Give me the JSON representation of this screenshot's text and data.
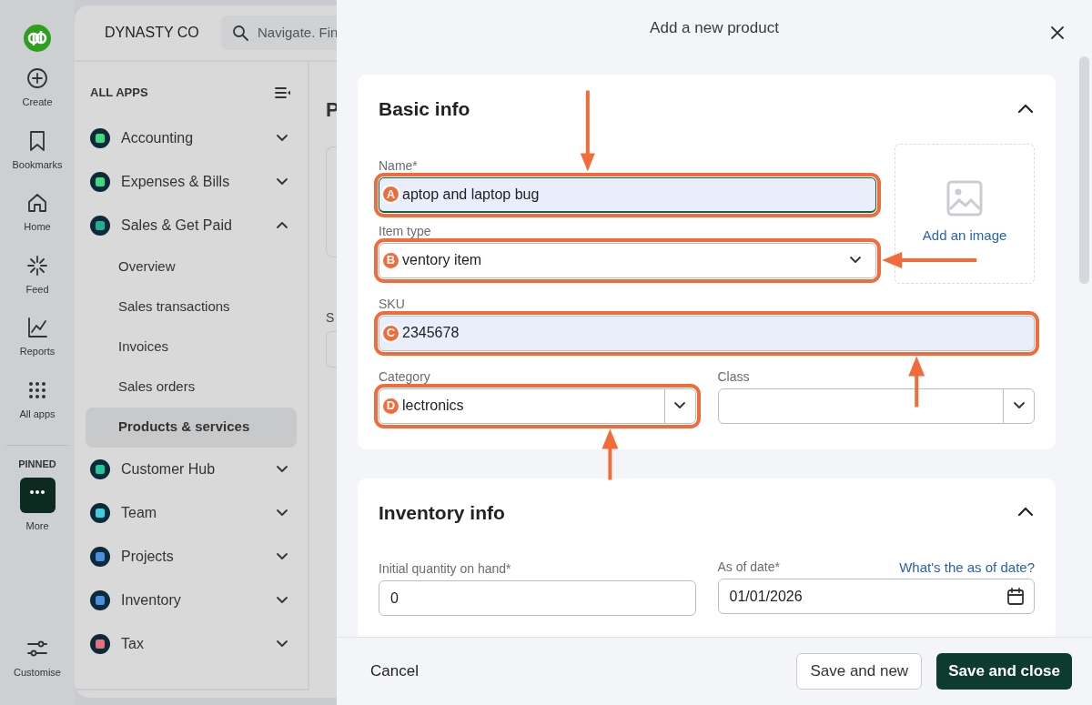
{
  "rail": {
    "items": [
      {
        "label": "Create"
      },
      {
        "label": "Bookmarks"
      },
      {
        "label": "Home"
      },
      {
        "label": "Feed"
      },
      {
        "label": "Reports"
      },
      {
        "label": "All apps"
      }
    ],
    "pinned_heading": "PINNED",
    "pinned": [
      {
        "label": "More"
      }
    ],
    "bottom": {
      "label": "Customise"
    }
  },
  "header": {
    "company": "DYNASTY CO",
    "search": {
      "placeholder": "Navigate. Fin"
    }
  },
  "sidebar": {
    "heading": "ALL APPS",
    "apps": [
      {
        "label": "Accounting",
        "color": "#3ddc84",
        "expanded": false
      },
      {
        "label": "Expenses & Bills",
        "color": "#3ddc84",
        "expanded": false
      },
      {
        "label": "Sales & Get Paid",
        "color": "#21b08e",
        "expanded": true,
        "children": [
          {
            "label": "Overview",
            "selected": false
          },
          {
            "label": "Sales transactions",
            "selected": false
          },
          {
            "label": "Invoices",
            "selected": false
          },
          {
            "label": "Sales orders",
            "selected": false
          },
          {
            "label": "Products & services",
            "selected": true
          }
        ]
      },
      {
        "label": "Customer Hub",
        "color": "#1ec9a0",
        "expanded": false
      },
      {
        "label": "Team",
        "color": "#3ecfe0",
        "expanded": false
      },
      {
        "label": "Projects",
        "color": "#4a8fe0",
        "expanded": false
      },
      {
        "label": "Inventory",
        "color": "#4a8fe0",
        "expanded": false
      },
      {
        "label": "Tax",
        "color": "#e8707a",
        "expanded": false
      }
    ]
  },
  "page": {
    "title": "P",
    "label": "S"
  },
  "drawer": {
    "title": "Add a new product",
    "sections": [
      {
        "title": "Basic info",
        "expanded": true,
        "image": {
          "label": "Add an image"
        },
        "fields": [
          {
            "kind": "text",
            "label": "Name*",
            "value": "aptop and laptop bug",
            "marker": "A",
            "highlighted": true,
            "arrow": {
              "kind": "down"
            },
            "autofilled": true,
            "focused": true
          },
          {
            "kind": "dropdown",
            "label": "Item type",
            "value": "ventory item",
            "marker": "B",
            "highlighted": true,
            "arrow": {
              "kind": "left"
            },
            "autofilled": false,
            "focused": false
          },
          {
            "kind": "text",
            "label": "SKU",
            "value": "2345678",
            "marker": "C",
            "highlighted": true,
            "arrow": {
              "kind": "up"
            },
            "autofilled": true,
            "focused": false
          },
          {
            "kind": "combo",
            "label": "Category",
            "value": "lectronics",
            "marker": "D",
            "highlighted": true,
            "arrow": {
              "kind": "up"
            },
            "autofilled": false,
            "focused": false
          },
          {
            "kind": "combo",
            "label": "Class",
            "highlighted": false,
            "autofilled": false,
            "focused": false
          }
        ]
      },
      {
        "title": "Inventory info",
        "expanded": true,
        "link": "What's the as of date?",
        "fields": [
          {
            "kind": "text",
            "label": "Initial quantity on hand*",
            "value": "0",
            "highlighted": false,
            "autofilled": false,
            "focused": false
          },
          {
            "kind": "date",
            "label": "As of date*",
            "value": "01/01/2026",
            "highlighted": false,
            "autofilled": false,
            "focused": false
          }
        ]
      }
    ],
    "footer": {
      "cancel": "Cancel",
      "secondary": "Save and new",
      "primary": "Save and close"
    }
  }
}
